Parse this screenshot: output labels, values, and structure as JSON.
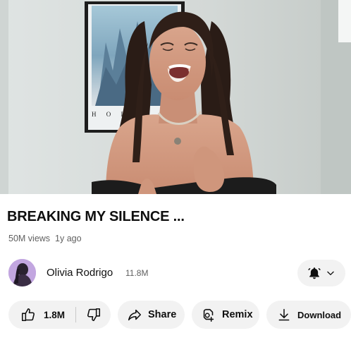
{
  "video": {
    "title": "BREAKING MY SILENCE ...",
    "views": "50M views",
    "age": "1y ago",
    "poster_text": "H O L L"
  },
  "channel": {
    "name": "Olivia Rodrigo",
    "subscribers": "11.8M"
  },
  "actions": {
    "likes": "1.8M",
    "share_label": "Share",
    "remix_label": "Remix",
    "download_label": "Download"
  },
  "icons": {
    "like": "thumb-up-icon",
    "dislike": "thumb-down-icon",
    "share": "share-arrow-icon",
    "remix": "remix-icon",
    "download": "download-icon",
    "bell": "bell-icon",
    "chevron": "chevron-down-icon"
  },
  "colors": {
    "pill_background": "#f2f2f2",
    "text_primary": "#0f0f0f",
    "text_secondary": "#606060"
  }
}
